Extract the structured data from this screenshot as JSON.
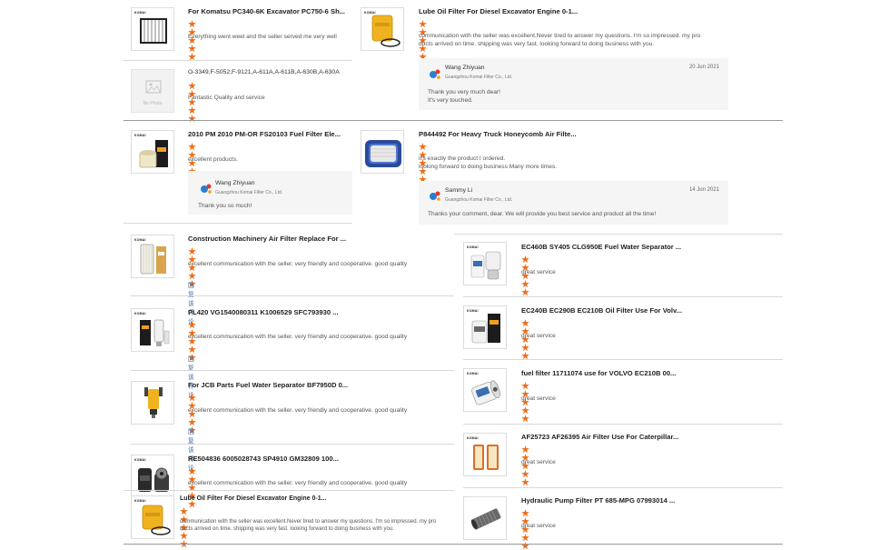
{
  "accent_color": "#f06b14",
  "brand_mark": "KOMAI",
  "reply_link_label": "回复该评论",
  "no_photo_label": "No Photo",
  "left": {
    "r1": {
      "title": "For Komatsu PC340-6K Excavator PC750-6 Sh...",
      "comment": "Everything went weel and the seller served me very well",
      "rating": 5,
      "icon": "panel-filter-icon"
    },
    "r2": {
      "title": "O-3349,F-5052,F-9121,A-611A,A-611B,A-630B,A-630A",
      "comment": "Fantastic Quality and service",
      "rating": 5,
      "icon": "no-photo-icon"
    },
    "r3": {
      "title": "2010 PM 2010 PM-OR FS20103 Fuel Filter Ele...",
      "comment": "excellent products.",
      "rating": 5,
      "icon": "fuel-filter-box-icon",
      "reply": {
        "name": "Wang Zhiyuan",
        "company": "Guangzhou Komai Filter Co., Ltd.",
        "text": "Thank you so much!"
      }
    },
    "r4": {
      "title": "Construction Machinery Air Filter Replace For ...",
      "comment": "excellent communication with the seller. very friendly and cooperative.  good quality",
      "rating": 5,
      "icon": "air-filter-icon"
    },
    "r5": {
      "title": "PL420 VG1540080311 K1006529 SFC793930 ...",
      "comment": "excellent communication with the seller. very friendly and cooperative.  good quality",
      "rating": 5,
      "icon": "filter-set-icon"
    },
    "r6": {
      "title": "For JCB Parts Fuel Water Separator BF7950D 0...",
      "comment": "excellent communication with the seller. very friendly and cooperative.  good quality",
      "rating": 5,
      "icon": "water-separator-icon"
    },
    "r7": {
      "title": "RE504836 6005028743 SP4910 GM32809 100...",
      "comment": "excellent communication with the seller. very friendly and cooperative.  good quality",
      "rating": 5,
      "icon": "spin-on-filter-icon"
    },
    "r8": {
      "title": "Lube Oil Filter For Diesel Excavator Engine 0-1...",
      "comment_line1": "communication with the seller was excellent.Never tired to answer my questions. I'm so impressed. my pro",
      "comment_line2": "ducts arrived on time. shipping was very fast. looking forward to doing business with you.",
      "rating": 5,
      "icon": "lube-oil-filter-icon"
    }
  },
  "middle": {
    "r1": {
      "title": "Lube Oil Filter For Diesel Excavator Engine 0-1...",
      "comment_line1": "communication with the seller was excellent.Never tired to answer my questions. I'm so impressed. my pro",
      "comment_line2": "ducts arrived on time. shipping was very fast. looking forward to doing business with you.",
      "rating": 5,
      "icon": "lube-oil-filter-icon",
      "reply": {
        "name": "Wang Zhiyuan",
        "company": "Guangzhou Komai Filter Co., Ltd.",
        "date": "20 Jun 2021",
        "line1": "Thank you very much dear!",
        "line2": "It's very touched."
      }
    },
    "r2": {
      "title": "P844492 For Heavy Truck Honeycomb Air Filte...",
      "comment_line1": "it's exactly the product I ordered.",
      "comment_line2": "looking forward to doing business Many more times.",
      "rating": 5,
      "icon": "honeycomb-air-filter-icon",
      "reply": {
        "name": "Sammy Li",
        "company": "Guangzhou Komai Filter Co., Ltd.",
        "date": "14 Jun 2021",
        "line1": "Thanks your comment, dear. We will provide you best service and product all the time!"
      }
    }
  },
  "right": {
    "r1": {
      "title": "EC460B SY405 CLG950E Fuel Water Separator ...",
      "comment": "great service",
      "rating": 5,
      "icon": "fuel-water-separator-icon"
    },
    "r2": {
      "title": "EC240B EC290B EC210B Oil Filter Use For Volv...",
      "comment": "great service",
      "rating": 5,
      "icon": "oil-filter-box-icon"
    },
    "r3": {
      "title": "fuel filter 11711074 use for VOLVO EC210B 00...",
      "comment": "great service",
      "rating": 5,
      "icon": "volvo-fuel-filter-icon"
    },
    "r4": {
      "title": "AF25723 AF26395 Air Filter Use For Caterpillar...",
      "comment": "great service",
      "rating": 5,
      "icon": "caterpillar-air-filter-icon"
    },
    "r5": {
      "title": "Hydraulic Pump Filter PT 685-MPG 07993014 ...",
      "comment": "great service",
      "rating": 5,
      "icon": "hydraulic-filter-icon"
    }
  }
}
